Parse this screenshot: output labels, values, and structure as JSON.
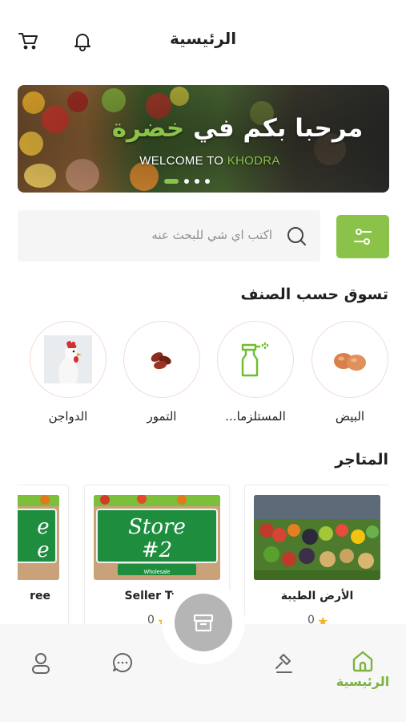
{
  "header": {
    "title": "الرئيسية"
  },
  "banner": {
    "headline_main": "مرحبا بكم في ",
    "headline_accent": "خضرة",
    "subtitle_main": "WELCOME TO ",
    "subtitle_accent": "KHODRA",
    "slide_count": 4,
    "active_slide": 1
  },
  "search": {
    "placeholder": "اكتب اي شي للبحث عنه"
  },
  "categories": {
    "title": "تسوق حسب الصنف",
    "items": [
      {
        "label": "البيض",
        "icon": "eggs-icon"
      },
      {
        "label": "المستلزما...",
        "icon": "spray-bottle-icon"
      },
      {
        "label": "التمور",
        "icon": "dates-icon"
      },
      {
        "label": "الدواجن",
        "icon": "rooster-icon"
      }
    ]
  },
  "stores": {
    "title": "المتاجر",
    "items": [
      {
        "name": "الأرض الطيبة",
        "rating": "0"
      },
      {
        "name": "Seller Two",
        "rating": "0",
        "sign_line1": "Store",
        "sign_line2": "#2",
        "sign_sub": "Wholesale"
      },
      {
        "name": "ree",
        "sign_line1": "e",
        "sign_line2": "e"
      }
    ]
  },
  "bottom_nav": {
    "home_label": "الرئيسية"
  },
  "colors": {
    "accent": "#8bc34a",
    "nav_active": "#7cb342",
    "star": "#f3b625"
  }
}
